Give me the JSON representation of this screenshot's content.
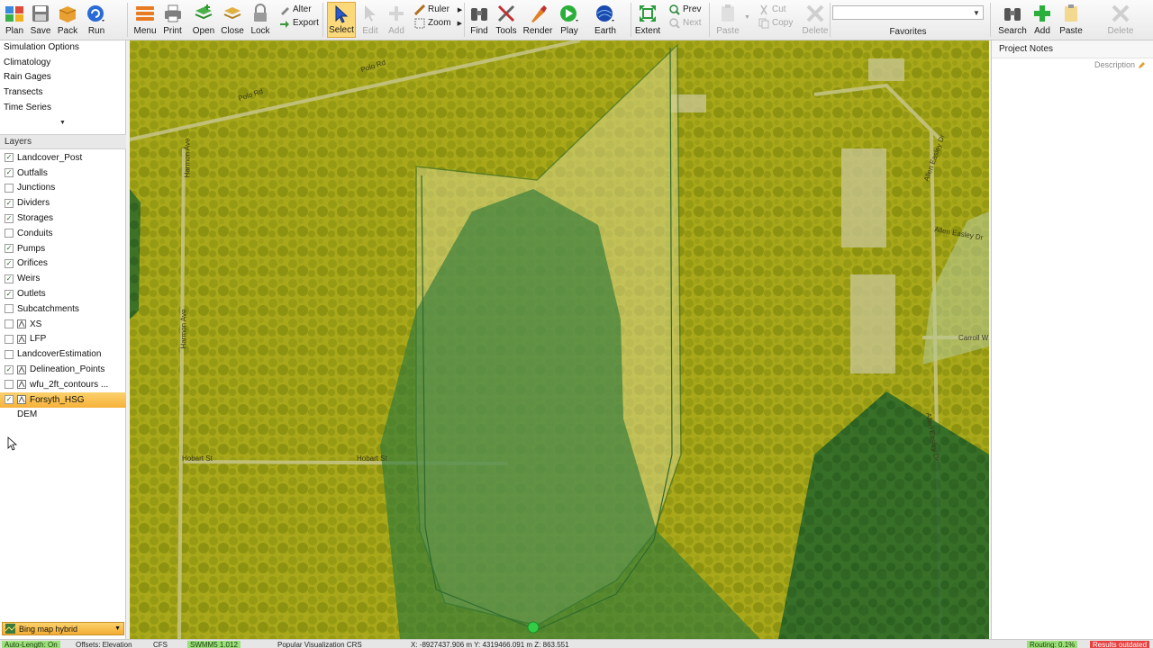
{
  "toolbar": {
    "plan": "Plan",
    "save": "Save",
    "pack": "Pack",
    "run": "Run",
    "menu": "Menu",
    "print": "Print",
    "open": "Open",
    "close": "Close",
    "lock": "Lock",
    "alter": "Alter",
    "export": "Export",
    "select": "Select",
    "edit": "Edit",
    "add": "Add",
    "ruler": "Ruler",
    "zoom": "Zoom",
    "find": "Find",
    "tools": "Tools",
    "render": "Render",
    "play": "Play",
    "earth": "Earth",
    "extent": "Extent",
    "prev": "Prev",
    "next": "Next",
    "paste": "Paste",
    "cut": "Cut",
    "copy": "Copy",
    "delete": "Delete",
    "favorites": "Favorites",
    "search": "Search",
    "add2": "Add",
    "paste2": "Paste",
    "delete2": "Delete"
  },
  "nav": {
    "items": [
      "Simulation Options",
      "Climatology",
      "Rain Gages",
      "Transects",
      "Time Series"
    ],
    "more": "▼"
  },
  "layers": {
    "header": "Layers",
    "items": [
      {
        "label": "Landcover_Post",
        "checked": true,
        "icon": false
      },
      {
        "label": "Outfalls",
        "checked": true,
        "icon": false
      },
      {
        "label": "Junctions",
        "checked": false,
        "icon": false
      },
      {
        "label": "Dividers",
        "checked": true,
        "icon": false
      },
      {
        "label": "Storages",
        "checked": true,
        "icon": false
      },
      {
        "label": "Conduits",
        "checked": false,
        "icon": false
      },
      {
        "label": "Pumps",
        "checked": true,
        "icon": false
      },
      {
        "label": "Orifices",
        "checked": true,
        "icon": false
      },
      {
        "label": "Weirs",
        "checked": true,
        "icon": false
      },
      {
        "label": "Outlets",
        "checked": true,
        "icon": false
      },
      {
        "label": "Subcatchments",
        "checked": false,
        "icon": false
      },
      {
        "label": "XS",
        "checked": false,
        "icon": true
      },
      {
        "label": "LFP",
        "checked": false,
        "icon": true
      },
      {
        "label": "LandcoverEstimation",
        "checked": false,
        "icon": false
      },
      {
        "label": "Delineation_Points",
        "checked": true,
        "icon": true
      },
      {
        "label": "wfu_2ft_contours ...",
        "checked": false,
        "icon": true
      },
      {
        "label": "Forsyth_HSG",
        "checked": true,
        "icon": true,
        "selected": true
      },
      {
        "label": "DEM",
        "checked": false,
        "icon": false,
        "nocb": true
      }
    ]
  },
  "basemap": {
    "label": "Bing map hybrid",
    "arrow": "▼"
  },
  "map": {
    "roads": {
      "polo1": "Polo Rd",
      "polo2": "Polo Rd",
      "harmon1": "Harmon Ave",
      "harmon2": "Harmon Ave",
      "hobart1": "Hobart St",
      "hobart2": "Hobart St",
      "allen1": "Allen Easley Dr",
      "allen2": "Allen Easley Dr",
      "allen3": "Allen Easley Dr",
      "carroll": "Carroll W"
    },
    "colors": {
      "overlay_yellow": "#c8c400",
      "overlay_light": "#d8d68a",
      "overlay_green": "#2e7a3a",
      "outlet": "#33cc44"
    }
  },
  "right_panel": {
    "title": "Project Notes",
    "description": "Description"
  },
  "status": {
    "auto_length": "Auto-Length: On",
    "offsets": "Offsets: Elevation",
    "units": "CFS",
    "engine": "SWMM5 1.012",
    "crs": "Popular Visualization CRS",
    "coords": "X: -8927437.906 m  Y: 4319466.091 m  Z: 863.551",
    "routing": "Routing: 0.1%",
    "results": "Results outdated"
  }
}
